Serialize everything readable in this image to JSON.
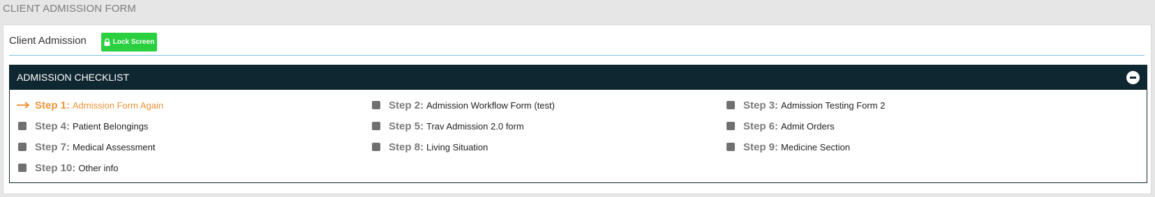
{
  "page": {
    "title": "CLIENT ADMISSION FORM"
  },
  "panel": {
    "title": "Client Admission",
    "lock_button": "Lock Screen"
  },
  "checklist": {
    "title": "ADMISSION CHECKLIST",
    "steps": [
      {
        "label": "Step 1:",
        "name": "Admission Form Again",
        "active": true
      },
      {
        "label": "Step 2:",
        "name": "Admission Workflow Form (test)",
        "active": false
      },
      {
        "label": "Step 3:",
        "name": "Admission Testing Form 2",
        "active": false
      },
      {
        "label": "Step 4:",
        "name": "Patient Belongings",
        "active": false
      },
      {
        "label": "Step 5:",
        "name": "Trav Admission 2.0 form",
        "active": false
      },
      {
        "label": "Step 6:",
        "name": "Admit Orders",
        "active": false
      },
      {
        "label": "Step 7:",
        "name": "Medical Assessment",
        "active": false
      },
      {
        "label": "Step 8:",
        "name": "Living Situation",
        "active": false
      },
      {
        "label": "Step 9:",
        "name": "Medicine Section",
        "active": false
      },
      {
        "label": "Step 10:",
        "name": "Other info",
        "active": false
      }
    ]
  },
  "colors": {
    "header_bg": "#0f2731",
    "lock_button_bg": "#2ad03f",
    "active_step": "#f0943a",
    "inactive_marker": "#707070",
    "divider": "#7cc2dd"
  },
  "icons": {
    "lock": "lock-icon",
    "active_arrow": "arrow-right-icon",
    "collapse": "minus-circle-icon"
  }
}
